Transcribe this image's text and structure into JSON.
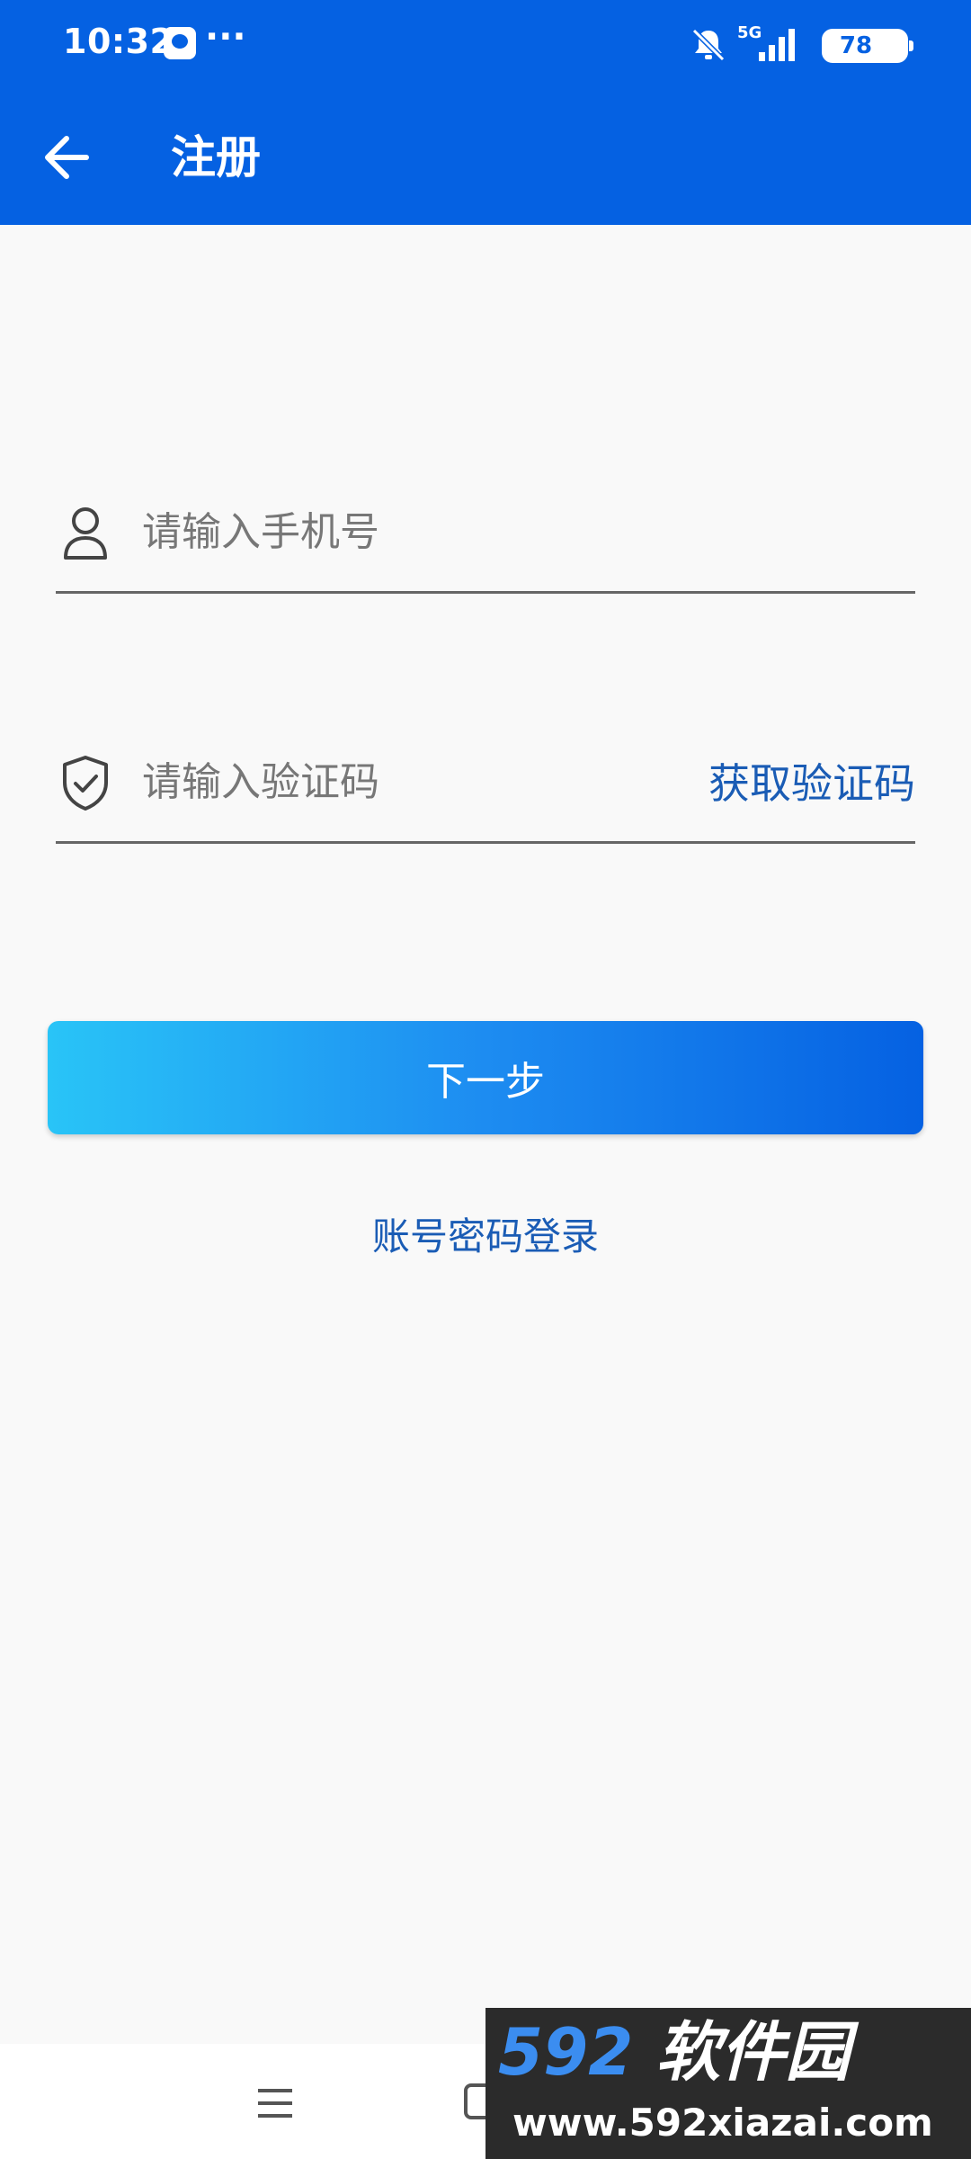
{
  "status_bar": {
    "time": "10:32",
    "dots": "···",
    "network": "5G",
    "battery": "78"
  },
  "toolbar": {
    "title": "注册"
  },
  "form": {
    "phone_placeholder": "请输入手机号",
    "code_placeholder": "请输入验证码",
    "get_code_label": "获取验证码",
    "next_label": "下一步",
    "password_login_label": "账号密码登录"
  },
  "watermark": {
    "number": "592",
    "name": "软件园",
    "url": "www.592xiazai.com"
  },
  "colors": {
    "primary": "#0561e2",
    "link": "#1a5cb5",
    "gradient_start": "#29c4f7",
    "gradient_end": "#0561e2",
    "background": "#f9f9f9"
  }
}
